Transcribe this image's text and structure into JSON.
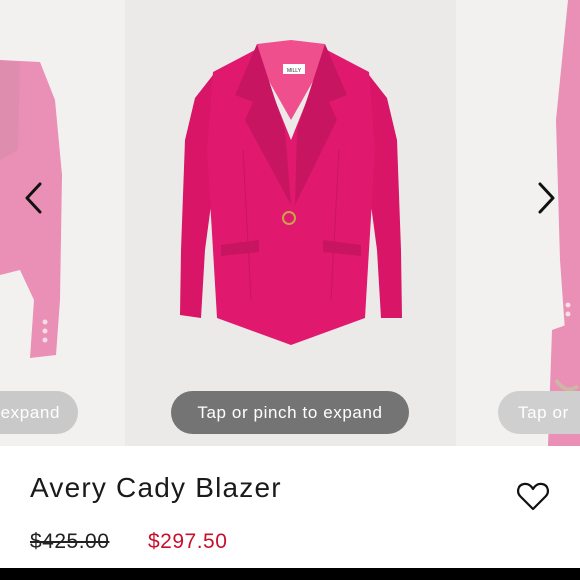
{
  "carousel": {
    "current_hint": "Tap or pinch to expand",
    "prev_hint": "expand",
    "next_hint": "Tap or",
    "brand_label": "MILLY"
  },
  "product": {
    "title": "Avery Cady Blazer",
    "original_price": "$425.00",
    "sale_price": "$297.50"
  },
  "colors": {
    "blazer": "#e0196e",
    "sale_price": "#c8102e",
    "pill": "#747474"
  }
}
